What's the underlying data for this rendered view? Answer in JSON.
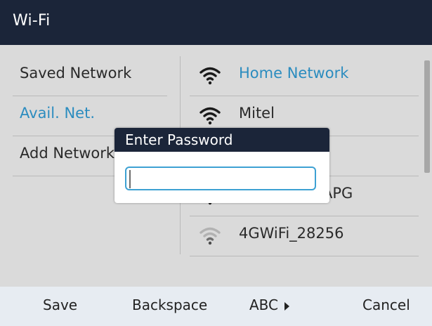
{
  "window": {
    "title": "Wi-Fi"
  },
  "menu": {
    "items": [
      {
        "label": "Saved Network",
        "active": false
      },
      {
        "label": "Avail. Net.",
        "active": true
      },
      {
        "label": "Add Network",
        "active": false
      }
    ]
  },
  "networks": [
    {
      "name": "Home Network",
      "icon": "wifi-full-icon",
      "connected": true
    },
    {
      "name": "Mitel",
      "icon": "wifi-full-icon",
      "connected": false
    },
    {
      "name": "",
      "icon": "wifi-full-icon",
      "connected": false
    },
    {
      "name": "APG",
      "icon": "wifi-full-icon",
      "connected": false
    },
    {
      "name": "4GWiFi_28256",
      "icon": "wifi-weak-icon",
      "connected": false
    }
  ],
  "dialog": {
    "title": "Enter Password",
    "password_value": "",
    "password_placeholder": ""
  },
  "softkeys": {
    "save": "Save",
    "backspace": "Backspace",
    "abc": "ABC",
    "cancel": "Cancel"
  },
  "colors": {
    "title_bar": "#1b2539",
    "content_bg": "#dadada",
    "accent": "#2b8cbf",
    "softkey_bar": "#e7ecf2",
    "input_border": "#3da1d3"
  }
}
